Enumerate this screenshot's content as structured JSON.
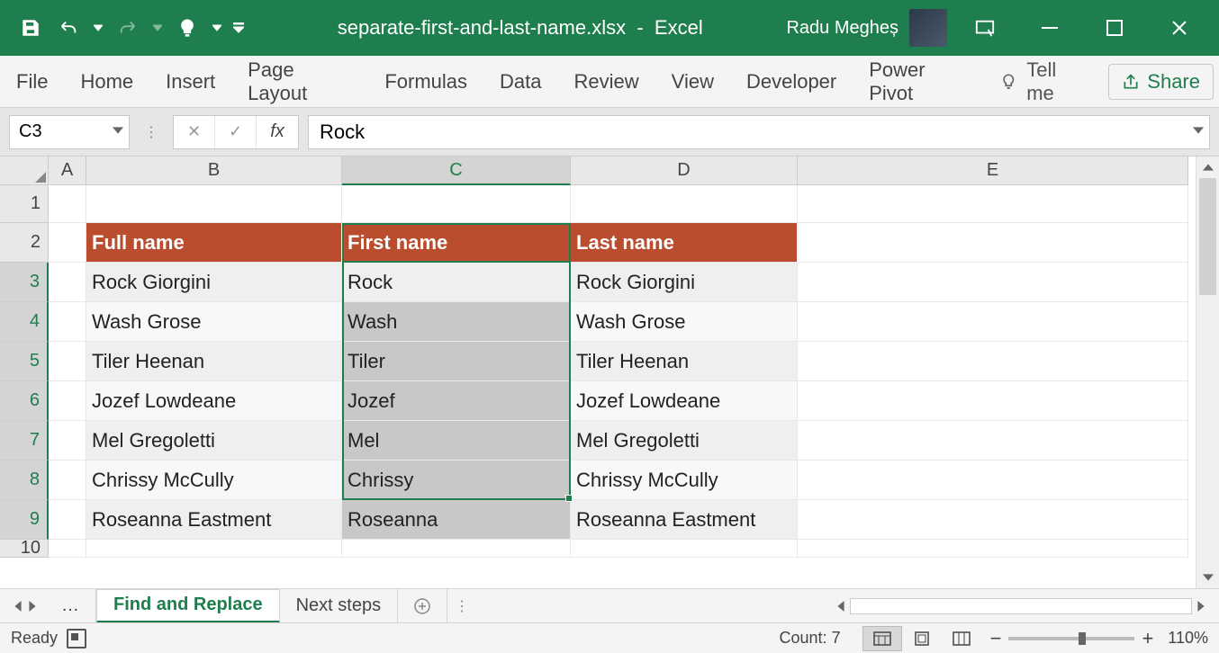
{
  "titlebar": {
    "filename": "separate-first-and-last-name.xlsx",
    "app": "Excel",
    "sep": "-",
    "user": "Radu Megheș"
  },
  "ribbon": {
    "tabs": [
      "File",
      "Home",
      "Insert",
      "Page Layout",
      "Formulas",
      "Data",
      "Review",
      "View",
      "Developer",
      "Power Pivot"
    ],
    "tell_me": "Tell me",
    "share": "Share"
  },
  "formula": {
    "name_box": "C3",
    "value": "Rock"
  },
  "columns": {
    "A": 42,
    "B": 284,
    "C": 254,
    "D": 252,
    "E": 434
  },
  "table": {
    "headers": {
      "b": "Full name",
      "c": "First name",
      "d": "Last name"
    },
    "rows": [
      {
        "b": "Rock Giorgini",
        "c": "Rock",
        "d": "Rock Giorgini"
      },
      {
        "b": "Wash Grose",
        "c": "Wash",
        "d": "Wash Grose"
      },
      {
        "b": "Tiler Heenan",
        "c": "Tiler",
        "d": "Tiler Heenan"
      },
      {
        "b": "Jozef Lowdeane",
        "c": "Jozef",
        "d": "Jozef Lowdeane"
      },
      {
        "b": "Mel Gregoletti",
        "c": "Mel",
        "d": "Mel Gregoletti"
      },
      {
        "b": "Chrissy McCully",
        "c": "Chrissy",
        "d": "Chrissy McCully"
      },
      {
        "b": "Roseanna Eastment",
        "c": "Roseanna",
        "d": "Roseanna Eastment"
      }
    ]
  },
  "tabs": {
    "active": "Find and Replace",
    "other": "Next steps",
    "ellipsis": "…"
  },
  "status": {
    "ready": "Ready",
    "count_label": "Count:",
    "count_value": "7",
    "zoom": "110%"
  },
  "selection": {
    "active_cell": "C3",
    "range": "C3:C9"
  }
}
